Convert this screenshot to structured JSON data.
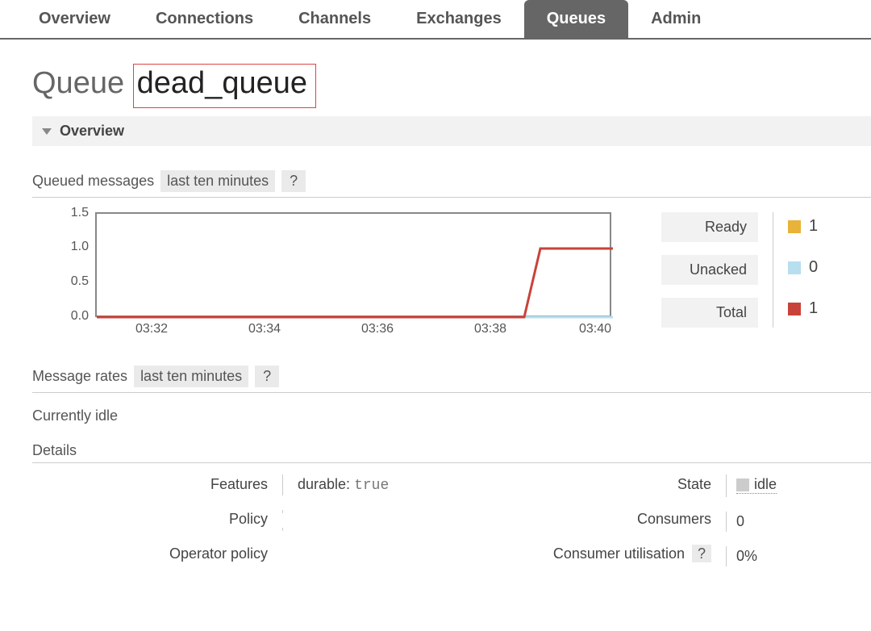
{
  "tabs": {
    "overview": "Overview",
    "connections": "Connections",
    "channels": "Channels",
    "exchanges": "Exchanges",
    "queues": "Queues",
    "admin": "Admin"
  },
  "page": {
    "title_prefix": "Queue",
    "queue_name": "dead_queue",
    "section": "Overview"
  },
  "queued_messages": {
    "label": "Queued messages",
    "range": "last ten minutes",
    "help": "?"
  },
  "legend": {
    "ready_label": "Ready",
    "ready_value": "1",
    "unacked_label": "Unacked",
    "unacked_value": "0",
    "total_label": "Total",
    "total_value": "1"
  },
  "message_rates": {
    "label": "Message rates",
    "range": "last ten minutes",
    "help": "?",
    "idle": "Currently idle"
  },
  "details": {
    "header": "Details",
    "features_label": "Features",
    "features_key": "durable:",
    "features_val": "true",
    "policy_label": "Policy",
    "operator_policy_label": "Operator policy",
    "state_label": "State",
    "state_value": "idle",
    "consumers_label": "Consumers",
    "consumers_value": "0",
    "consumer_util_label": "Consumer utilisation",
    "consumer_util_help": "?",
    "consumer_util_value": "0%"
  },
  "chart_data": {
    "type": "line",
    "xlabel": "",
    "ylabel": "",
    "ylim": [
      0,
      1.5
    ],
    "y_ticks": [
      "1.5",
      "1.0",
      "0.5",
      "0.0"
    ],
    "x_ticks": [
      "03:32",
      "03:34",
      "03:36",
      "03:38",
      "03:40"
    ],
    "series": [
      {
        "name": "Ready",
        "color": "#e9b33a",
        "values": [
          0,
          0,
          0,
          0,
          0,
          0,
          0,
          0,
          1,
          1
        ]
      },
      {
        "name": "Unacked",
        "color": "#b7dff0",
        "values": [
          0,
          0,
          0,
          0,
          0,
          0,
          0,
          0,
          0,
          0
        ]
      },
      {
        "name": "Total",
        "color": "#c9423a",
        "values": [
          0,
          0,
          0,
          0,
          0,
          0,
          0,
          0,
          1,
          1
        ]
      }
    ]
  }
}
